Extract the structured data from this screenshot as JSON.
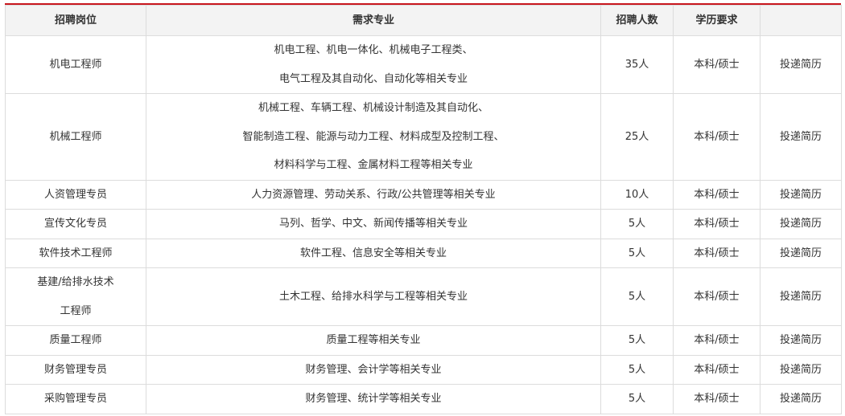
{
  "table": {
    "headers": [
      "招聘岗位",
      "需求专业",
      "招聘人数",
      "学历要求",
      ""
    ],
    "rows": [
      {
        "position": [
          "机电工程师"
        ],
        "majors": [
          "机电工程、机电一体化、机械电子工程类、",
          "电气工程及其自动化、自动化等相关专业"
        ],
        "count": "35人",
        "education": "本科/硕士",
        "action": "投递简历"
      },
      {
        "position": [
          "机械工程师"
        ],
        "majors": [
          "机械工程、车辆工程、机械设计制造及其自动化、",
          "智能制造工程、能源与动力工程、材料成型及控制工程、",
          "材料科学与工程、金属材料工程等相关专业"
        ],
        "count": "25人",
        "education": "本科/硕士",
        "action": "投递简历"
      },
      {
        "position": [
          "人资管理专员"
        ],
        "majors": [
          "人力资源管理、劳动关系、行政/公共管理等相关专业"
        ],
        "count": "10人",
        "education": "本科/硕士",
        "action": "投递简历"
      },
      {
        "position": [
          "宣传文化专员"
        ],
        "majors": [
          "马列、哲学、中文、新闻传播等相关专业"
        ],
        "count": "5人",
        "education": "本科/硕士",
        "action": "投递简历"
      },
      {
        "position": [
          "软件技术工程师"
        ],
        "majors": [
          "软件工程、信息安全等相关专业"
        ],
        "count": "5人",
        "education": "本科/硕士",
        "action": "投递简历"
      },
      {
        "position": [
          "基建/给排水技术",
          "工程师"
        ],
        "majors": [
          "土木工程、给排水科学与工程等相关专业"
        ],
        "count": "5人",
        "education": "本科/硕士",
        "action": "投递简历"
      },
      {
        "position": [
          "质量工程师"
        ],
        "majors": [
          "质量工程等相关专业"
        ],
        "count": "5人",
        "education": "本科/硕士",
        "action": "投递简历"
      },
      {
        "position": [
          "财务管理专员"
        ],
        "majors": [
          "财务管理、会计学等相关专业"
        ],
        "count": "5人",
        "education": "本科/硕士",
        "action": "投递简历"
      },
      {
        "position": [
          "采购管理专员"
        ],
        "majors": [
          "财务管理、统计学等相关专业"
        ],
        "count": "5人",
        "education": "本科/硕士",
        "action": "投递简历"
      }
    ]
  },
  "colors": {
    "accent_rule": "#c8161d",
    "header_bg": "#f3f3f3",
    "border": "#dcdcdc",
    "text": "#333333"
  }
}
